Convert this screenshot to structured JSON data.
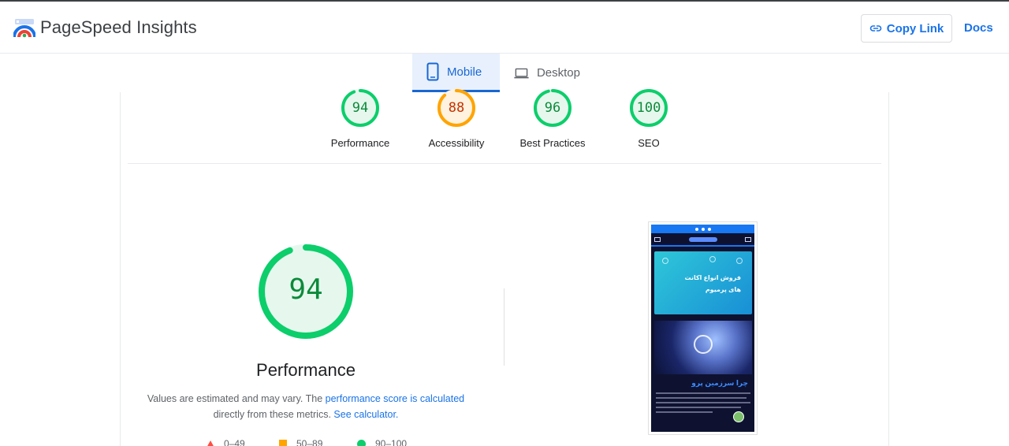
{
  "app": {
    "title": "PageSpeed Insights",
    "copy_link_label": "Copy Link",
    "docs_label": "Docs"
  },
  "tabs": [
    {
      "label": "Mobile",
      "active": true
    },
    {
      "label": "Desktop",
      "active": false
    }
  ],
  "scores": [
    {
      "label": "Performance",
      "value": "94",
      "color": "#0cce6b",
      "text_color": "#0c8a3a",
      "bg": "#e6f8ee"
    },
    {
      "label": "Accessibility",
      "value": "88",
      "color": "#ffa400",
      "text_color": "#c33300",
      "bg": "#fff3e0"
    },
    {
      "label": "Best Practices",
      "value": "96",
      "color": "#0cce6b",
      "text_color": "#0c8a3a",
      "bg": "#e6f8ee"
    },
    {
      "label": "SEO",
      "value": "100",
      "color": "#0cce6b",
      "text_color": "#0c8a3a",
      "bg": "#e6f8ee"
    }
  ],
  "performance": {
    "score": "94",
    "score_fraction": 0.94,
    "title": "Performance",
    "desc_prefix": "Values are estimated and may vary. The ",
    "desc_link1": "performance score is calculated",
    "desc_mid": "directly from these metrics. ",
    "desc_link2": "See calculator."
  },
  "legend": [
    {
      "label": "0–49",
      "shape": "triangle"
    },
    {
      "label": "50–89",
      "shape": "square"
    },
    {
      "label": "90–100",
      "shape": "circle"
    }
  ],
  "screenshot": {
    "banner_text_line1": "فروش انواع اکانت",
    "banner_text_line2": "های پرمیوم",
    "heading": "چرا سرزمین پرو"
  }
}
